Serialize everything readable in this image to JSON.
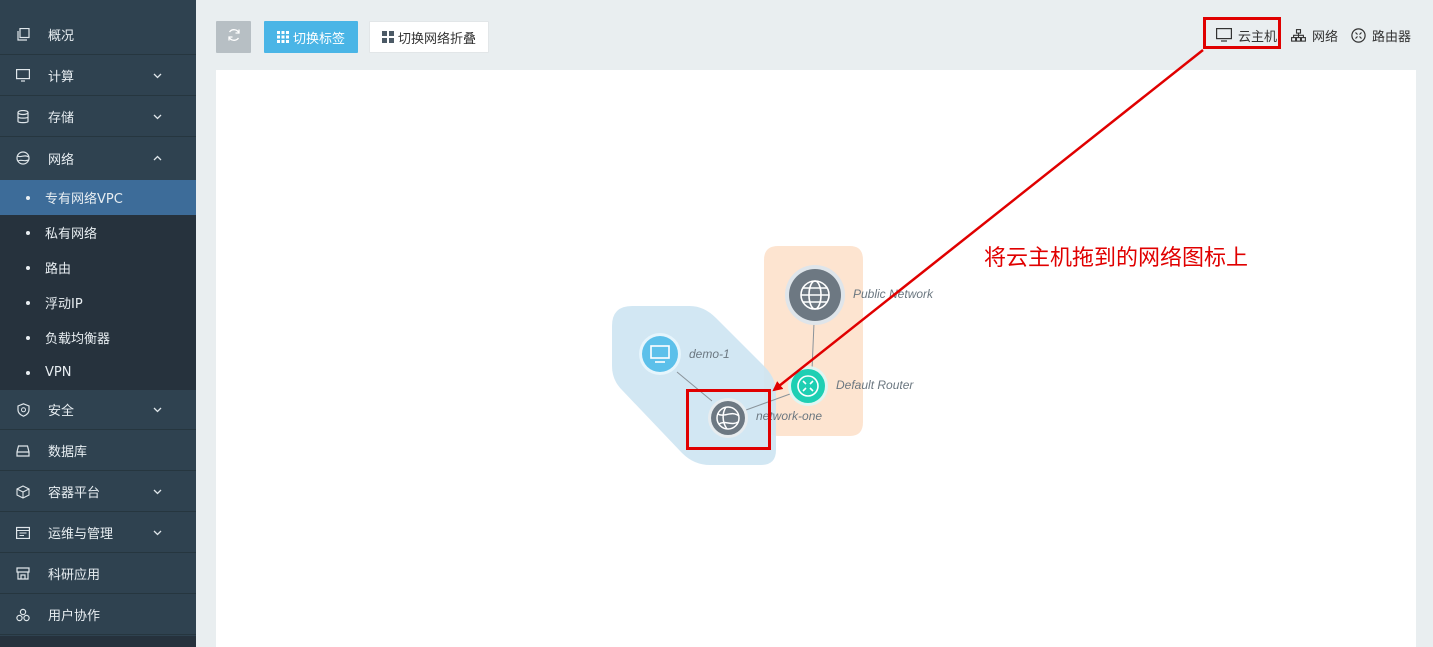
{
  "sidebar": {
    "items": [
      {
        "label": "概况",
        "icon": "copy-icon"
      },
      {
        "label": "计算",
        "icon": "monitor-icon"
      },
      {
        "label": "存储",
        "icon": "database-icon"
      },
      {
        "label": "网络",
        "icon": "network-globe-icon"
      },
      {
        "label": "安全",
        "icon": "shield-icon"
      },
      {
        "label": "数据库",
        "icon": "drive-icon"
      },
      {
        "label": "容器平台",
        "icon": "cube-icon"
      },
      {
        "label": "运维与管理",
        "icon": "calendar-icon"
      },
      {
        "label": "科研应用",
        "icon": "store-icon"
      },
      {
        "label": "用户协作",
        "icon": "users-icon"
      }
    ],
    "network_subitems": [
      {
        "label": "专有网络VPC",
        "active": true
      },
      {
        "label": "私有网络"
      },
      {
        "label": "路由"
      },
      {
        "label": "浮动IP"
      },
      {
        "label": "负载均衡器"
      },
      {
        "label": "VPN"
      }
    ]
  },
  "toolbar": {
    "refresh_icon": "refresh-icon",
    "toggle_tags_label": "切换标签",
    "toggle_network_fold_label": "切换网络折叠"
  },
  "legend": {
    "vm_label": "云主机",
    "network_label": "网络",
    "router_label": "路由器"
  },
  "topology": {
    "nodes": [
      {
        "label": "demo-1",
        "type": "vm"
      },
      {
        "label": "network-one",
        "type": "network"
      },
      {
        "label": "Public Network",
        "type": "network"
      },
      {
        "label": "Default Router",
        "type": "router"
      }
    ],
    "colors": {
      "private_group": "#cde4f2",
      "public_group": "#fde1cb",
      "vm_node": "#5cc0ea",
      "network_node": "#6d7882",
      "router_node": "#1ecfb3",
      "highlight": "#e00000"
    }
  },
  "annotation": {
    "text": "将云主机拖到的网络图标上"
  }
}
